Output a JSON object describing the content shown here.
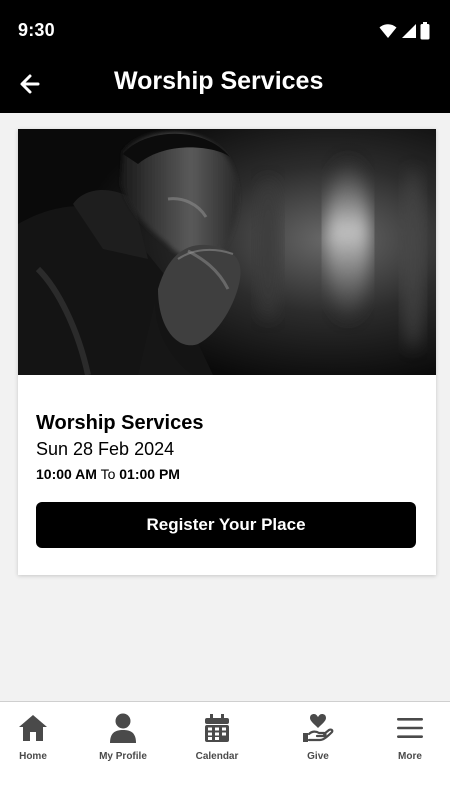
{
  "status_bar": {
    "time": "9:30",
    "icons": [
      "wifi-icon",
      "signal-icon",
      "battery-icon"
    ]
  },
  "app_bar": {
    "title": "Worship Services",
    "back_icon": "arrow-left-icon"
  },
  "event": {
    "image_alt": "man-praying-photo",
    "title": "Worship Services",
    "date": "Sun 28 Feb 2024",
    "start_time": "10:00 AM",
    "time_separator": " To ",
    "end_time": "01:00 PM",
    "register_label": "Register Your Place"
  },
  "bottom_nav": {
    "items": [
      {
        "label": "Home",
        "icon": "home-icon"
      },
      {
        "label": "My Profile",
        "icon": "profile-icon"
      },
      {
        "label": "Calendar",
        "icon": "calendar-icon"
      },
      {
        "label": "Give",
        "icon": "give-icon"
      },
      {
        "label": "More",
        "icon": "menu-icon"
      }
    ]
  },
  "colors": {
    "bar_background": "#000000",
    "content_background": "#f2f2f2",
    "nav_icon": "#4a4a4a"
  }
}
